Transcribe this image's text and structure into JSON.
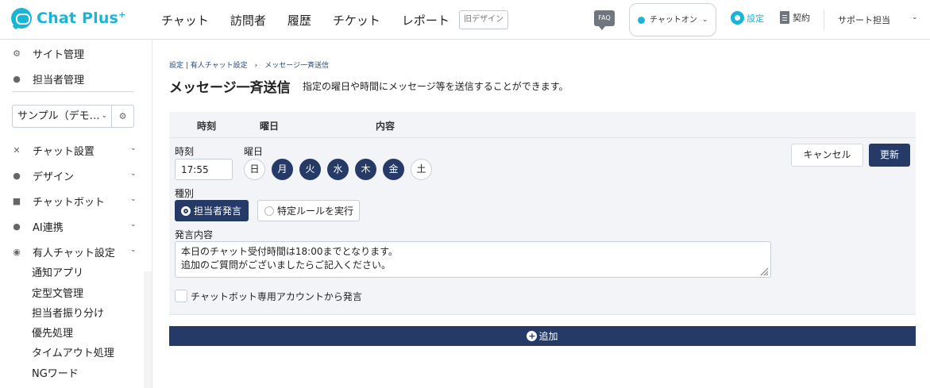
{
  "header": {
    "logo_text": "Chat Plus",
    "logo_sup": "+",
    "nav": [
      "チャット",
      "訪問者",
      "履歴",
      "チケット",
      "レポート"
    ],
    "old_design_label": "旧デザイン",
    "faq_label": "FAQ",
    "status_label": "チャットオン",
    "settings_label": "設定",
    "contract_label": "契約",
    "user_label": "サポート担当",
    "accent_color": "#19b5d6"
  },
  "sidebar": {
    "site_management": "サイト管理",
    "staff_management": "担当者管理",
    "site_select_value": "サンプル（デモ…",
    "chat_settings": "チャット設置",
    "design": "デザイン",
    "chatbot": "チャットボット",
    "ai": "AI連携",
    "manned_chat": "有人チャット設定",
    "sub_items": [
      "通知アプリ",
      "定型文管理",
      "担当者振り分け",
      "優先処理",
      "タイムアウト処理",
      "NGワード"
    ]
  },
  "main": {
    "breadcrumb": "設定 | 有人チャット設定　›　メッセージ一斉送信",
    "title": "メッセージ一斉送信",
    "description": "指定の曜日や時間にメッセージ等を送信することができます。",
    "table_headers": {
      "time": "時刻",
      "day": "曜日",
      "content": "内容"
    },
    "form": {
      "time_label": "時刻",
      "time_value": "17:55",
      "day_label": "曜日",
      "days": [
        {
          "label": "日",
          "selected": false
        },
        {
          "label": "月",
          "selected": true
        },
        {
          "label": "火",
          "selected": true
        },
        {
          "label": "水",
          "selected": true
        },
        {
          "label": "木",
          "selected": true
        },
        {
          "label": "金",
          "selected": true
        },
        {
          "label": "土",
          "selected": false
        }
      ],
      "type_label": "種別",
      "type_option_staff": "担当者発言",
      "type_option_rule": "特定ルールを実行",
      "message_label": "発言内容",
      "message_value": "本日のチャット受付時間は18:00までとなります。\n追加のご質問がございましたらご記入ください。",
      "chatbot_account_label": "チャットボット専用アカウントから発言",
      "chatbot_account_checked": false,
      "cancel_label": "キャンセル",
      "update_label": "更新"
    },
    "add_label": "追加",
    "primary_color": "#253a66"
  }
}
